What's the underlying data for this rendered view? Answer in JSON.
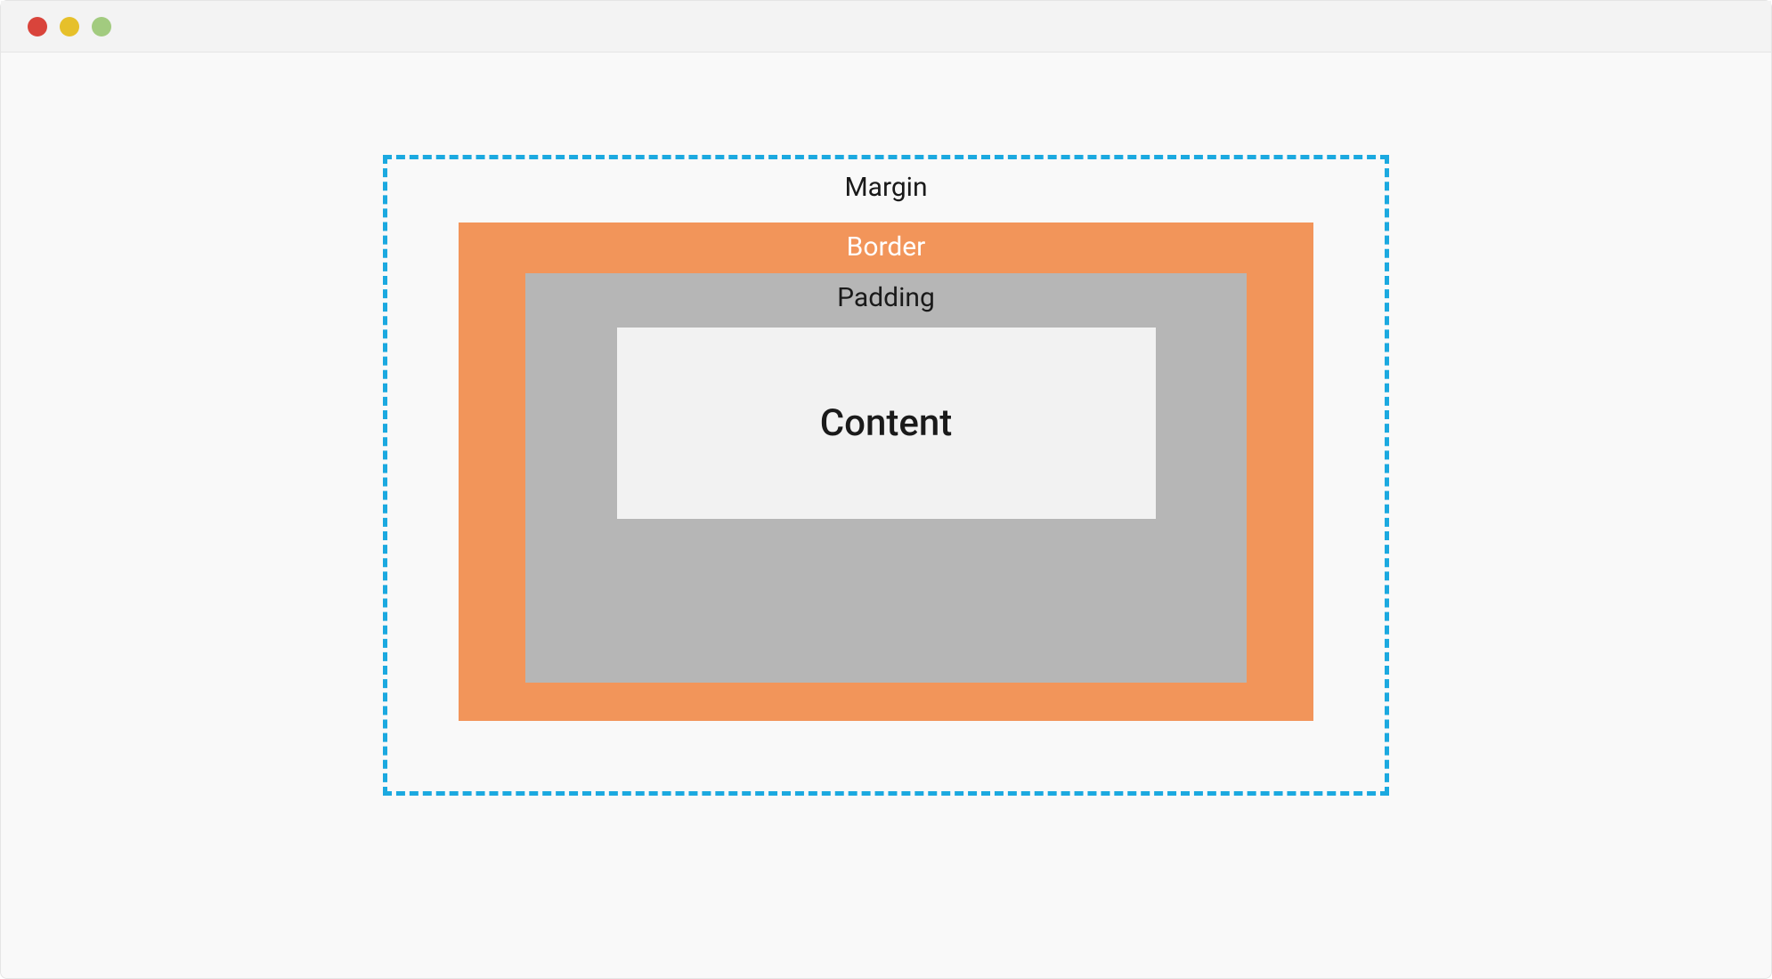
{
  "boxModel": {
    "marginLabel": "Margin",
    "borderLabel": "Border",
    "paddingLabel": "Padding",
    "contentLabel": "Content"
  },
  "colors": {
    "marginBorder": "#1ba9e0",
    "borderFill": "#f2955a",
    "paddingFill": "#b6b6b6",
    "contentFill": "#f2f2f2"
  }
}
